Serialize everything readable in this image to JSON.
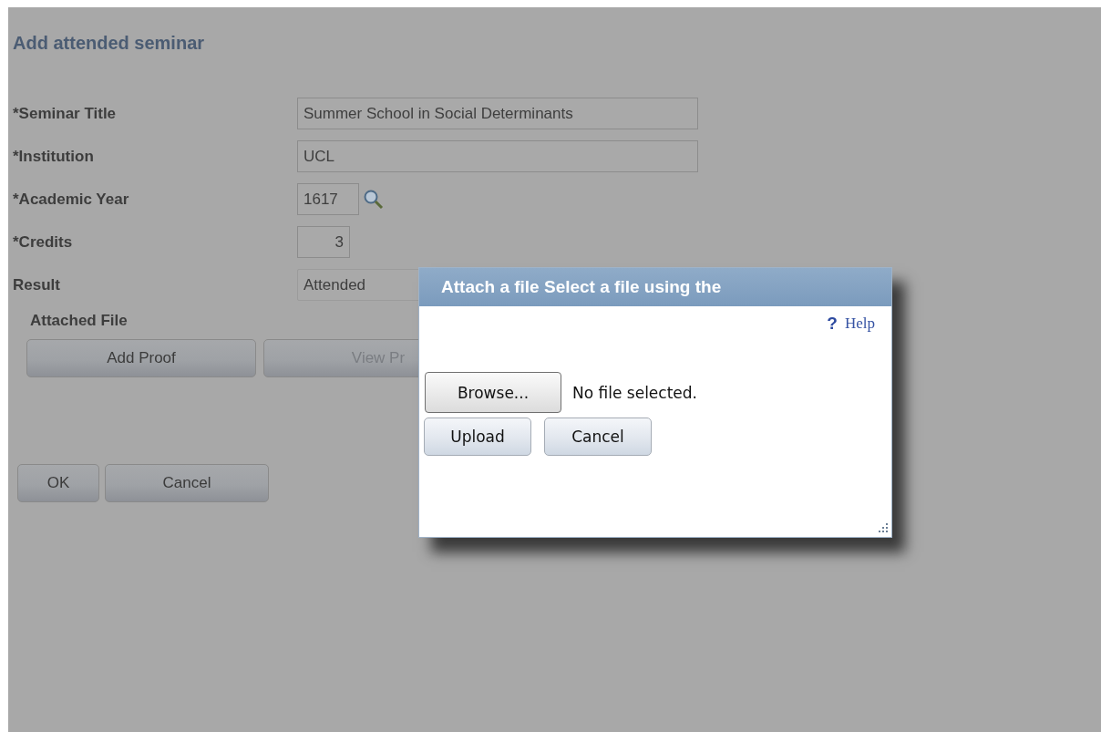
{
  "page": {
    "title": "Add attended seminar",
    "fields": [
      {
        "label": "*Seminar Title",
        "value": "Summer School in Social Determinants",
        "kind": "text"
      },
      {
        "label": "*Institution",
        "value": "UCL",
        "kind": "text"
      },
      {
        "label": "*Academic Year",
        "value": "1617",
        "kind": "lookup"
      },
      {
        "label": "*Credits",
        "value": "3",
        "kind": "number"
      },
      {
        "label": "Result",
        "value": "Attended",
        "kind": "select"
      }
    ],
    "attached_file_label": "Attached File",
    "attachment_buttons": [
      {
        "label": "Add Proof",
        "disabled": false
      },
      {
        "label": "View Pr",
        "disabled": true
      }
    ],
    "buttons": [
      "OK",
      "Cancel"
    ]
  },
  "dialog": {
    "title": "Attach a file Select a file using the",
    "help": "Help",
    "help_icon": "?",
    "browse_button": "Browse...",
    "file_status": "No file selected.",
    "buttons": [
      "Upload",
      "Cancel"
    ]
  }
}
